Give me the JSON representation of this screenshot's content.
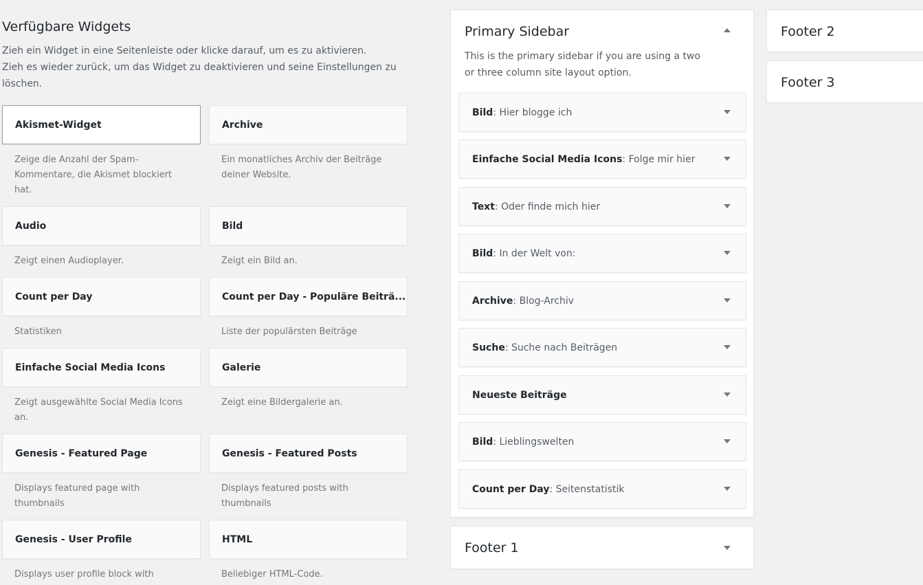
{
  "available": {
    "heading": "Verfügbare Widgets",
    "desc_line1": "Zieh ein Widget in eine Seitenleiste oder klicke darauf, um es zu aktivieren.",
    "desc_line2": "Zieh es wieder zurück, um das Widget zu deaktivieren und seine Einstellungen zu löschen.",
    "widgets": [
      {
        "name": "Akismet-Widget",
        "desc": "Zeige die Anzahl der Spam-Kommentare, die Akismet blockiert hat."
      },
      {
        "name": "Archive",
        "desc": "Ein monatliches Archiv der Beiträge deiner Website."
      },
      {
        "name": "Audio",
        "desc": "Zeigt einen Audioplayer."
      },
      {
        "name": "Bild",
        "desc": "Zeigt ein Bild an."
      },
      {
        "name": "Count per Day",
        "desc": "Statistiken"
      },
      {
        "name": "Count per Day - Populäre Beiträ...",
        "desc": "Liste der populärsten Beiträge"
      },
      {
        "name": "Einfache Social Media Icons",
        "desc": "Zeigt ausgewählte Social Media Icons an."
      },
      {
        "name": "Galerie",
        "desc": "Zeigt eine Bildergalerie an."
      },
      {
        "name": "Genesis - Featured Page",
        "desc": "Displays featured page with thumbnails"
      },
      {
        "name": "Genesis - Featured Posts",
        "desc": "Displays featured posts with thumbnails"
      },
      {
        "name": "Genesis - User Profile",
        "desc": "Displays user profile block with"
      },
      {
        "name": "HTML",
        "desc": "Beliebiger HTML-Code."
      }
    ]
  },
  "primary_sidebar": {
    "title": "Primary Sidebar",
    "desc": "This is the primary sidebar if you are using a two or three column site layout option.",
    "widgets": [
      {
        "name": "Bild",
        "title": ": Hier blogge ich"
      },
      {
        "name": "Einfache Social Media Icons",
        "title": ": Folge mir hier"
      },
      {
        "name": "Text",
        "title": ": Oder finde mich hier"
      },
      {
        "name": "Bild",
        "title": ": In der Welt von:"
      },
      {
        "name": "Archive",
        "title": ": Blog-Archiv"
      },
      {
        "name": "Suche",
        "title": ": Suche nach Beiträgen"
      },
      {
        "name": "Neueste Beiträge",
        "title": ""
      },
      {
        "name": "Bild",
        "title": ": Lieblingswelten"
      },
      {
        "name": "Count per Day",
        "title": ": Seitenstatistik"
      }
    ]
  },
  "footer1": {
    "title": "Footer 1"
  },
  "footer2": {
    "title": "Footer 2"
  },
  "footer3": {
    "title": "Footer 3"
  }
}
